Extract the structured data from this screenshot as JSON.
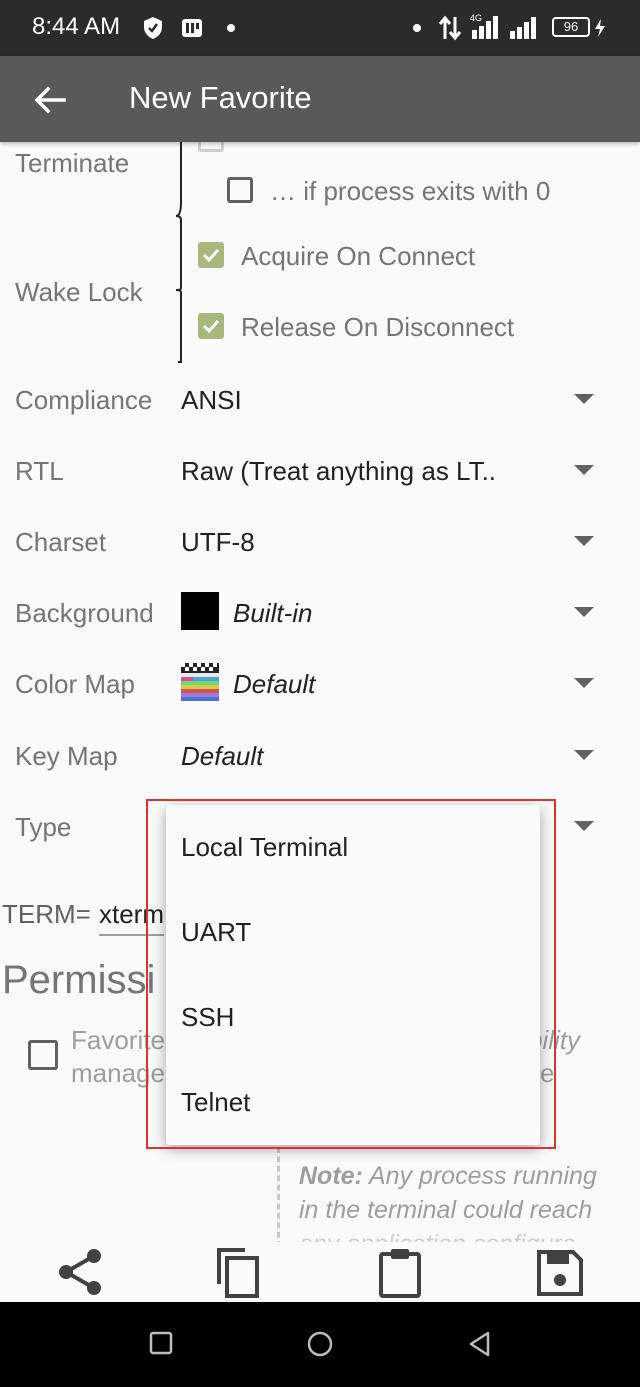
{
  "status_bar": {
    "time": "8:44 AM",
    "battery": "96"
  },
  "app_bar": {
    "title": "New Favorite"
  },
  "form": {
    "terminate_label": "Terminate",
    "if_exits_zero": "… if process exits with 0",
    "wake_lock_label": "Wake Lock",
    "acquire_on_connect": "Acquire On Connect",
    "release_on_disconnect": "Release On Disconnect",
    "compliance_label": "Compliance",
    "compliance_value": "ANSI",
    "rtl_label": "RTL",
    "rtl_value": "Raw (Treat anything as LT..",
    "charset_label": "Charset",
    "charset_value": "UTF-8",
    "background_label": "Background",
    "background_value": "Built-in",
    "colormap_label": "Color Map",
    "colormap_value": "Default",
    "keymap_label": "Key Map",
    "keymap_value": "Default",
    "type_label": "Type",
    "term_label": "TERM=",
    "term_value": "xterm",
    "permissions_heading": "Permissi",
    "permission_text_line1": "Favorite",
    "permission_text_line1_right": "bility",
    "permission_text_line2": "manage",
    "permission_text_line2_right": "e",
    "note_bold": "Note:",
    "note_line1": "Any process running",
    "note_line2": "in the terminal could reach",
    "note_line3": "any application configura-"
  },
  "type_dropdown": {
    "options": [
      "Local Terminal",
      "UART",
      "SSH",
      "Telnet"
    ]
  },
  "toolbar": [
    "share-icon",
    "copy-icon",
    "clipboard-icon",
    "save-icon"
  ],
  "navbar": [
    "recents-icon",
    "home-icon",
    "back-icon"
  ],
  "colors": {
    "accent_check": "#a9b87a",
    "app_bar": "#595959",
    "highlight": "#e03131"
  }
}
